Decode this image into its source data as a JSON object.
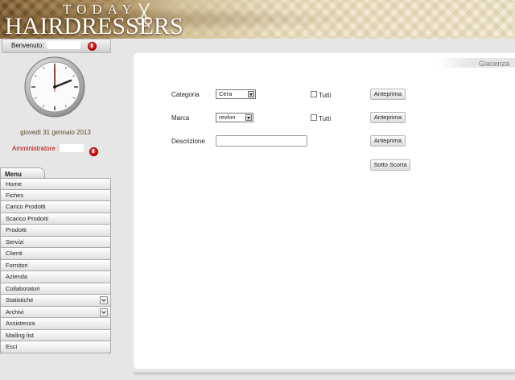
{
  "header": {
    "logo_top": "TODAY",
    "logo_main": "HAIRDRESSERS"
  },
  "welcome": {
    "label": "Benvenuto:"
  },
  "sidebar": {
    "date": "giovedì 31 gennaio 2013",
    "admin_label": "Amministratore : N",
    "menu_title": "Menu",
    "items": [
      {
        "label": "Home",
        "expandable": false
      },
      {
        "label": "Fiches",
        "expandable": false
      },
      {
        "label": "Carico Prodotti",
        "expandable": false
      },
      {
        "label": "Scarico Prodotti",
        "expandable": false
      },
      {
        "label": "Prodotti",
        "expandable": false
      },
      {
        "label": "Servizi",
        "expandable": false
      },
      {
        "label": "Clienti",
        "expandable": false
      },
      {
        "label": "Fornitori",
        "expandable": false
      },
      {
        "label": "Azienda",
        "expandable": false
      },
      {
        "label": "Collaboratori",
        "expandable": false
      },
      {
        "label": "Statistiche",
        "expandable": true
      },
      {
        "label": "Archivi",
        "expandable": true
      },
      {
        "label": "Assistenza",
        "expandable": false
      },
      {
        "label": "Mailing list",
        "expandable": false
      },
      {
        "label": "Esci",
        "expandable": false
      }
    ]
  },
  "main": {
    "title": "Giacenza",
    "categoria": {
      "label": "Categoria",
      "value": "Cera"
    },
    "marca": {
      "label": "Marca",
      "value": "revlon"
    },
    "descrizione": {
      "label": "Descrizione",
      "value": ""
    },
    "tutti_label": "Tutti",
    "anteprima_label": "Anteprima",
    "sotto_scorta_label": "Sotto Scorta"
  },
  "icons": {
    "power": "power-icon",
    "chevron": "chevron-down-icon",
    "clock": "clock-icon"
  },
  "colors": {
    "admin_text": "#c00000",
    "date_text": "#5a4a2a",
    "panel_title": "#777777"
  }
}
